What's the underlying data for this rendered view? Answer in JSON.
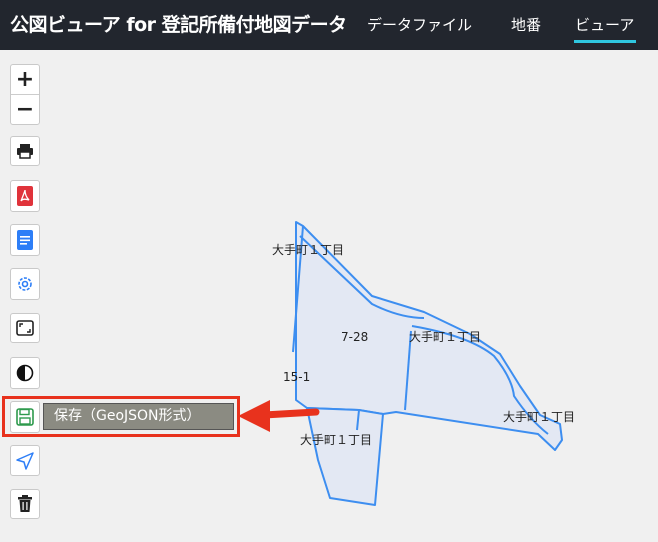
{
  "app": {
    "title": "公図ビューア for 登記所備付地図データ"
  },
  "nav": {
    "items": [
      {
        "label": "データファイル"
      },
      {
        "label": "地番"
      },
      {
        "label": "ビューア",
        "active": true
      }
    ],
    "accent_color": "#2fc7e0"
  },
  "toolbar": {
    "zoom_in": "+",
    "zoom_out": "−",
    "icons": [
      "printer-icon",
      "pdf-icon",
      "document-icon",
      "settings-icon",
      "frame-icon",
      "contrast-icon",
      "save-icon",
      "send-icon",
      "trash-icon"
    ],
    "save_tooltip": "保存（GeoJSON形式）"
  },
  "map": {
    "labels": [
      {
        "text": "大手町１丁目"
      },
      {
        "text": "7-28"
      },
      {
        "text": "大手町１丁目"
      },
      {
        "text": "15-1"
      },
      {
        "text": "大手町１丁目"
      },
      {
        "text": "大手町１丁目"
      }
    ],
    "parcel_fill": "#e3e8f3",
    "parcel_stroke": "#3d8ef0"
  },
  "annotation": {
    "highlight_color": "#e8321d"
  }
}
